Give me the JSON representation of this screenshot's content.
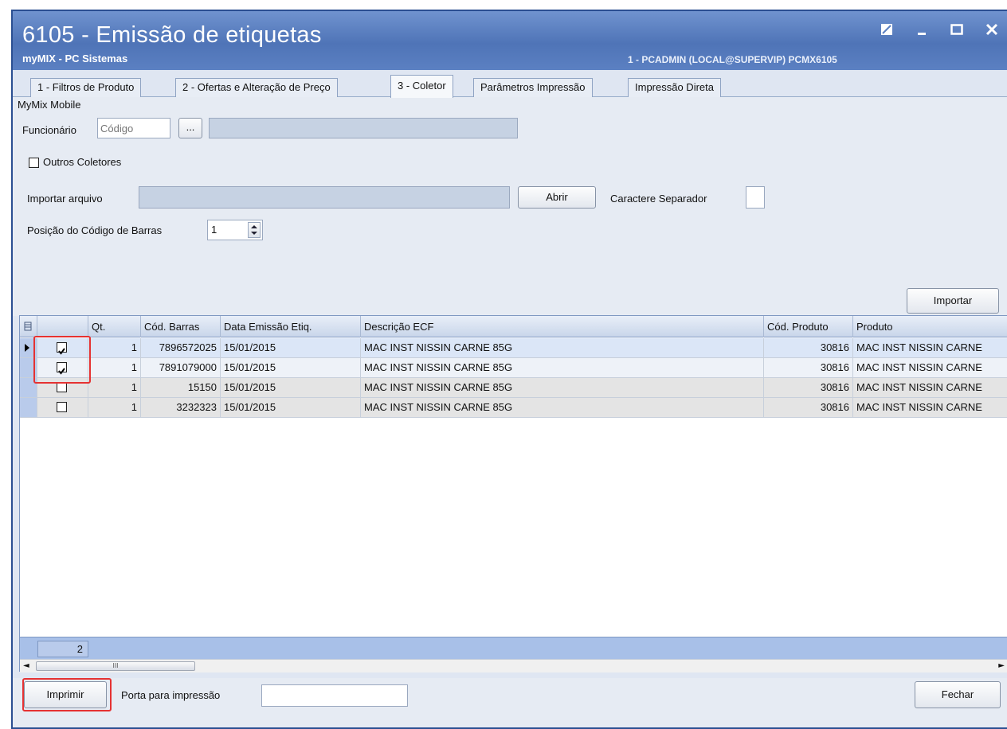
{
  "window": {
    "title": "6105 - Emissão de etiquetas",
    "subtitle": "myMIX - PC Sistemas",
    "user_info": "1 - PCADMIN (LOCAL@SUPERVIP)   PCMX6105"
  },
  "tabs": [
    {
      "label": "1 - Filtros de Produto",
      "active": false
    },
    {
      "label": "2 - Ofertas e Alteração de Preço",
      "active": false
    },
    {
      "label": "3 - Coletor",
      "active": true
    },
    {
      "label": "Parâmetros Impressão",
      "active": false
    },
    {
      "label": "Impressão Direta",
      "active": false
    }
  ],
  "form": {
    "group_label": "MyMix Mobile",
    "funcionario_label": "Funcionário",
    "funcionario_placeholder": "Código",
    "lookup_button": "...",
    "outros_coletores_label": "Outros Coletores",
    "outros_coletores_checked": false,
    "importar_arquivo_label": "Importar arquivo",
    "abrir_button": "Abrir",
    "separador_label": "Caractere Separador",
    "posicao_label": "Posição do Código de Barras",
    "posicao_value": "1",
    "importar_button": "Importar"
  },
  "grid": {
    "columns": [
      "Qt.",
      "Cód. Barras",
      "Data Emissão Etiq.",
      "Descrição ECF",
      "Cód. Produto",
      "Produto"
    ],
    "rows": [
      {
        "checked": true,
        "qt": "1",
        "barcode": "7896572025",
        "date": "15/01/2015",
        "desc": "MAC INST NISSIN CARNE 85G",
        "cod": "30816",
        "produto": "MAC INST NISSIN CARNE"
      },
      {
        "checked": true,
        "qt": "1",
        "barcode": "7891079000",
        "date": "15/01/2015",
        "desc": "MAC INST NISSIN CARNE 85G",
        "cod": "30816",
        "produto": "MAC INST NISSIN CARNE"
      },
      {
        "checked": false,
        "qt": "1",
        "barcode": "15150",
        "date": "15/01/2015",
        "desc": "MAC INST NISSIN CARNE 85G",
        "cod": "30816",
        "produto": "MAC INST NISSIN CARNE"
      },
      {
        "checked": false,
        "qt": "1",
        "barcode": "3232323",
        "date": "15/01/2015",
        "desc": "MAC INST NISSIN CARNE 85G",
        "cod": "30816",
        "produto": "MAC INST NISSIN CARNE"
      }
    ],
    "summary_count": "2",
    "scroll_grip": "III"
  },
  "bottom": {
    "imprimir_button": "Imprimir",
    "porta_label": "Porta para impressão",
    "fechar_button": "Fechar"
  }
}
